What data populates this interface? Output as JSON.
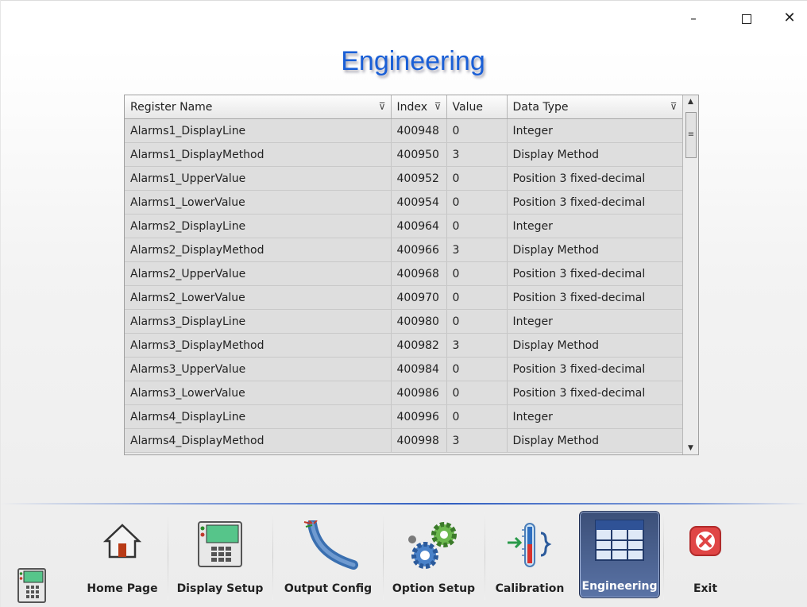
{
  "window": {
    "minimize_label": "–",
    "close_label": "✕"
  },
  "page_title": "Engineering",
  "grid": {
    "columns": [
      "Register Name",
      "Index",
      "Value",
      "Data Type"
    ],
    "rows": [
      [
        "Alarms1_DisplayLine",
        "400948",
        "0",
        "Integer"
      ],
      [
        "Alarms1_DisplayMethod",
        "400950",
        "3",
        "Display Method"
      ],
      [
        "Alarms1_UpperValue",
        "400952",
        "0",
        "Position 3 fixed-decimal"
      ],
      [
        "Alarms1_LowerValue",
        "400954",
        "0",
        "Position 3 fixed-decimal"
      ],
      [
        "Alarms2_DisplayLine",
        "400964",
        "0",
        "Integer"
      ],
      [
        "Alarms2_DisplayMethod",
        "400966",
        "3",
        "Display Method"
      ],
      [
        "Alarms2_UpperValue",
        "400968",
        "0",
        "Position 3 fixed-decimal"
      ],
      [
        "Alarms2_LowerValue",
        "400970",
        "0",
        "Position 3 fixed-decimal"
      ],
      [
        "Alarms3_DisplayLine",
        "400980",
        "0",
        "Integer"
      ],
      [
        "Alarms3_DisplayMethod",
        "400982",
        "3",
        "Display Method"
      ],
      [
        "Alarms3_UpperValue",
        "400984",
        "0",
        "Position 3 fixed-decimal"
      ],
      [
        "Alarms3_LowerValue",
        "400986",
        "0",
        "Position 3 fixed-decimal"
      ],
      [
        "Alarms4_DisplayLine",
        "400996",
        "0",
        "Integer"
      ],
      [
        "Alarms4_DisplayMethod",
        "400998",
        "3",
        "Display Method"
      ]
    ]
  },
  "nav": {
    "home": "Home Page",
    "display_setup": "Display Setup",
    "output_config": "Output Config",
    "option_setup": "Option Setup",
    "calibration": "Calibration",
    "engineering": "Engineering",
    "exit": "Exit",
    "active": "Engineering"
  },
  "colors": {
    "title": "#1a5fd6",
    "active_tab": "#46598a",
    "exit": "#e04545"
  }
}
